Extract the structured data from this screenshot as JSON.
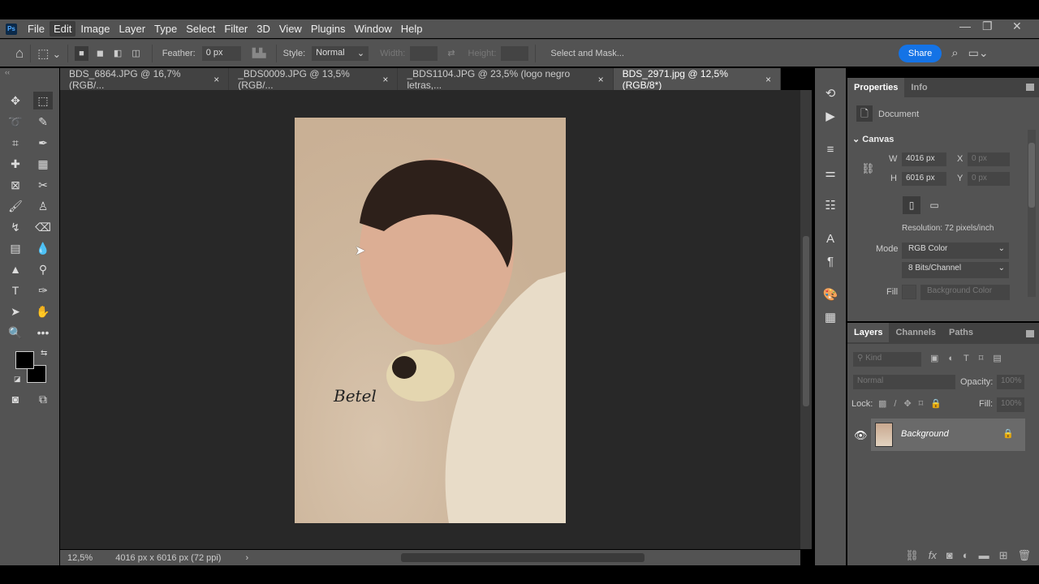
{
  "app": {
    "logo": "Ps"
  },
  "menu": [
    "File",
    "Edit",
    "Image",
    "Layer",
    "Type",
    "Select",
    "Filter",
    "3D",
    "View",
    "Plugins",
    "Window",
    "Help"
  ],
  "options": {
    "feather_label": "Feather:",
    "feather_value": "0 px",
    "style_label": "Style:",
    "style_value": "Normal",
    "width_label": "Width:",
    "height_label": "Height:",
    "select_mask": "Select and Mask...",
    "share": "Share"
  },
  "tabs": [
    {
      "label": "BDS_6864.JPG @ 16,7% (RGB/...",
      "close": "×"
    },
    {
      "label": "_BDS0009.JPG @ 13,5% (RGB/...",
      "close": "×"
    },
    {
      "label": "_BDS1104.JPG @ 23,5% (logo negro letras,...",
      "close": "×"
    },
    {
      "label": "BDS_2971.jpg @ 12,5% (RGB/8*)",
      "close": "×"
    }
  ],
  "status": {
    "zoom": "12,5%",
    "info": "4016 px x 6016 px (72 ppi)"
  },
  "properties": {
    "tab1": "Properties",
    "tab2": "Info",
    "doc": "Document",
    "canvas": "Canvas",
    "w_label": "W",
    "w": "4016 px",
    "h_label": "H",
    "h": "6016 px",
    "x_label": "X",
    "x": "0 px",
    "y_label": "Y",
    "y": "0 px",
    "resolution": "Resolution: 72 pixels/inch",
    "mode_label": "Mode",
    "mode": "RGB Color",
    "bits": "8 Bits/Channel",
    "fill_label": "Fill",
    "fill": "Background Color"
  },
  "layers": {
    "tab1": "Layers",
    "tab2": "Channels",
    "tab3": "Paths",
    "kind": "Kind",
    "blend": "Normal",
    "opacity_label": "Opacity:",
    "opacity": "100%",
    "lock_label": "Lock:",
    "fill_label": "Fill:",
    "fill": "100%",
    "layer_name": "Background"
  },
  "colors": {
    "accent": "#1473e6",
    "panel": "#535353",
    "canvas": "#282828"
  }
}
